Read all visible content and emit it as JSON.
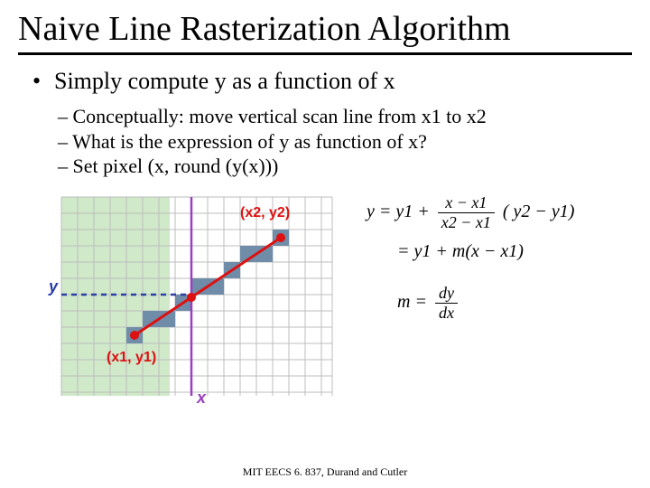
{
  "title": "Naive Line Rasterization Algorithm",
  "bullet1": "Simply compute y as a function of x",
  "sub": [
    "– Conceptually: move vertical scan line from x1 to x2",
    "– What is the expression of y as function of x?",
    "– Set pixel (x, round (y(x)))"
  ],
  "labels": {
    "x": "x",
    "y": "y",
    "p1": "(x1, y1)",
    "p2": "(x2, y2)"
  },
  "eq": {
    "lhs1": "y = y1 +",
    "frac1_num": "x − x1",
    "frac1_den": "x2 − x1",
    "rhs1": "( y2 − y1)",
    "line2a": "= y1 + m(x − x1)",
    "m_lhs": "m =",
    "m_num": "dy",
    "m_den": "dx"
  },
  "footer": "MIT EECS 6. 837, Durand and Cutler",
  "chart_data": {
    "type": "line",
    "title": "Line segment on pixel grid",
    "xlim": [
      -7,
      10
    ],
    "ylim": [
      -6,
      6
    ],
    "points": {
      "p1": {
        "x": -3,
        "y": -3,
        "label": "(x1, y1)"
      },
      "p2": {
        "x": 6,
        "y": 3,
        "label": "(x2, y2)"
      }
    },
    "vertical_scan_line_x": 0,
    "axes": {
      "xlabel": "x",
      "ylabel": "y"
    },
    "grid": true
  }
}
